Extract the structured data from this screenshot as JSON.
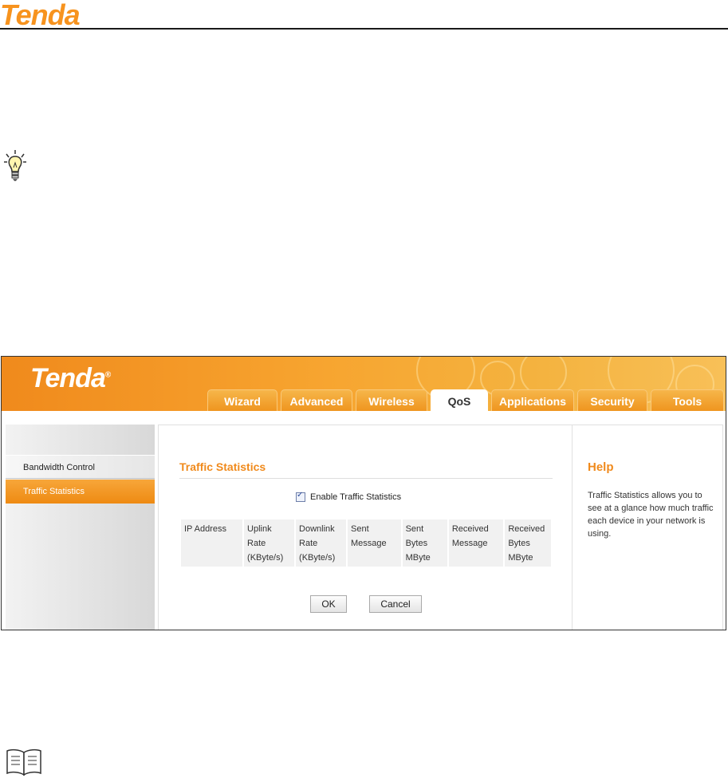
{
  "document": {
    "brand": "Tenda"
  },
  "app": {
    "brand": "Tenda",
    "trademark": "®",
    "tabs": [
      {
        "label": "Wizard"
      },
      {
        "label": "Advanced"
      },
      {
        "label": "Wireless"
      },
      {
        "label": "QoS"
      },
      {
        "label": "Applications"
      },
      {
        "label": "Security"
      },
      {
        "label": "Tools"
      }
    ],
    "active_tab": "QoS",
    "sidebar": {
      "items": [
        {
          "label": "Bandwidth Control"
        },
        {
          "label": "Traffic Statistics"
        }
      ],
      "active_item": "Traffic Statistics"
    },
    "main": {
      "title": "Traffic Statistics",
      "enable_label": "Enable Traffic Statistics",
      "enable_checked": true,
      "table_headers": [
        [
          "IP Address"
        ],
        [
          "Uplink",
          "Rate",
          "(KByte/s)"
        ],
        [
          "Downlink",
          "Rate",
          "(KByte/s)"
        ],
        [
          "Sent",
          "Message"
        ],
        [
          "Sent",
          "Bytes",
          "MByte"
        ],
        [
          "Received",
          "Message"
        ],
        [
          "Received",
          "Bytes",
          "MByte"
        ]
      ],
      "ok_label": "OK",
      "cancel_label": "Cancel"
    },
    "help": {
      "title": "Help",
      "text": "Traffic Statistics allows you to see at a glance how much traffic each device in your network is using."
    }
  },
  "colors": {
    "brand_orange": "#f08a1c",
    "tab_orange": "#ef951f"
  },
  "icons": [
    "lightbulb-tip-icon",
    "book-note-icon",
    "checkbox-checked-icon"
  ]
}
